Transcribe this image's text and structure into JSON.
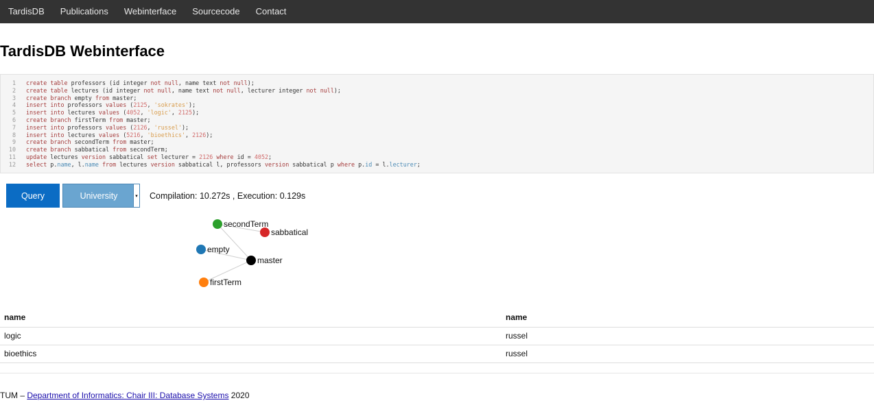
{
  "nav": {
    "items": [
      "TardisDB",
      "Publications",
      "Webinterface",
      "Sourcecode",
      "Contact"
    ]
  },
  "page": {
    "title": "TardisDB Webinterface"
  },
  "editor": {
    "line_numbers": [
      "1",
      "2",
      "3",
      "4",
      "5",
      "6",
      "7",
      "8",
      "9",
      "10",
      "11",
      "12"
    ],
    "lines": [
      "create table professors (id integer not null, name text not null);",
      "create table lectures (id integer not null, name text not null, lecturer integer not null);",
      "create branch empty from master;",
      "insert into professors values (2125, 'sokrates');",
      "insert into lectures values (4052, 'logic', 2125);",
      "create branch firstTerm from master;",
      "insert into professors values (2126, 'russel');",
      "insert into lectures values (5216, 'bioethics', 2126);",
      "create branch secondTerm from master;",
      "create branch sabbatical from secondTerm;",
      "update lectures version sabbatical set lecturer = 2126 where id = 4052;",
      "select p.name, l.name from lectures version sabbatical l, professors version sabbatical p where p.id = l.lecturer;"
    ]
  },
  "toolbar": {
    "query_label": "Query",
    "dataset_selected": "University",
    "timing": "Compilation: 10.272s , Execution: 0.129s"
  },
  "graph": {
    "nodes": [
      {
        "name": "secondTerm",
        "color": "#2ca02c"
      },
      {
        "name": "sabbatical",
        "color": "#d62728"
      },
      {
        "name": "empty",
        "color": "#1f77b4"
      },
      {
        "name": "master",
        "color": "#000000"
      },
      {
        "name": "firstTerm",
        "color": "#ff7f0e"
      }
    ],
    "edges": [
      [
        "secondTerm",
        "master"
      ],
      [
        "sabbatical",
        "secondTerm"
      ],
      [
        "empty",
        "master"
      ],
      [
        "firstTerm",
        "master"
      ]
    ]
  },
  "results": {
    "headers": [
      "name",
      "name"
    ],
    "rows": [
      [
        "logic",
        "russel"
      ],
      [
        "bioethics",
        "russel"
      ]
    ]
  },
  "footer": {
    "prefix": "TUM – ",
    "link": "Department of Informatics: Chair III: Database Systems",
    "suffix": " 2020"
  }
}
